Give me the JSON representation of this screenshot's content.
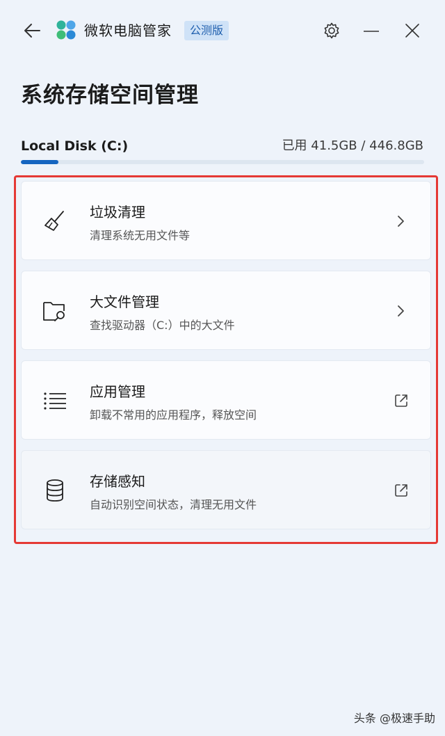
{
  "header": {
    "back_icon": "arrow-left-icon",
    "logo_icon": "pc-manager-logo",
    "app_name": "微软电脑管家",
    "badge": "公测版",
    "settings_icon": "gear-icon",
    "minimize_icon": "minimize-icon",
    "close_icon": "close-icon"
  },
  "page": {
    "title": "系统存储空间管理"
  },
  "disk": {
    "name": "Local Disk (C:)",
    "usage": "已用 41.5GB / 446.8GB",
    "used_fraction": 0.093
  },
  "cards": [
    {
      "icon": "broom-icon",
      "title": "垃圾清理",
      "description": "清理系统无用文件等",
      "action_icon": "chevron-right-icon"
    },
    {
      "icon": "folder-search-icon",
      "title": "大文件管理",
      "description": "查找驱动器（C:）中的大文件",
      "action_icon": "chevron-right-icon"
    },
    {
      "icon": "list-icon",
      "title": "应用管理",
      "description": "卸载不常用的应用程序，释放空间",
      "action_icon": "external-link-icon"
    },
    {
      "icon": "database-icon",
      "title": "存储感知",
      "description": "自动识别空间状态，清理无用文件",
      "action_icon": "external-link-icon"
    }
  ],
  "watermark": "头条 @极速手助",
  "colors": {
    "accent": "#1565c0",
    "highlight_border": "#e53935",
    "background": "#eef3fa",
    "badge_bg": "#cfe2f7"
  }
}
